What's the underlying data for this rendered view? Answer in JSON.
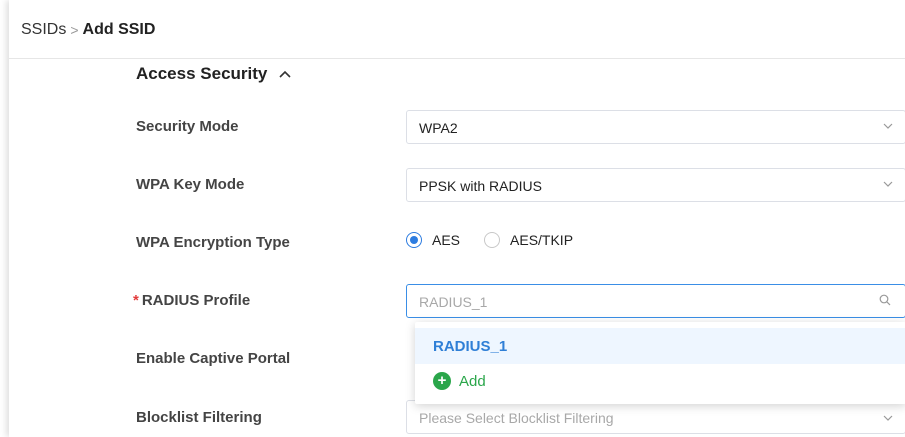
{
  "breadcrumb": {
    "parent": "SSIDs",
    "separator": ">",
    "current": "Add SSID"
  },
  "section": {
    "title": "Access Security"
  },
  "fields": {
    "security_mode": {
      "label": "Security Mode",
      "value": "WPA2"
    },
    "wpa_key_mode": {
      "label": "WPA Key Mode",
      "value": "PPSK with RADIUS"
    },
    "encryption": {
      "label": "WPA Encryption Type",
      "options": [
        "AES",
        "AES/TKIP"
      ],
      "selected": "AES"
    },
    "radius_profile": {
      "required_mark": "*",
      "label": "RADIUS Profile",
      "placeholder": "RADIUS_1"
    },
    "captive_portal": {
      "label": "Enable Captive Portal"
    },
    "blocklist": {
      "label": "Blocklist Filtering",
      "placeholder": "Please Select Blocklist Filtering"
    }
  },
  "dropdown": {
    "items": [
      "RADIUS_1"
    ],
    "add_label": "Add"
  },
  "colors": {
    "accent": "#2d7ce0",
    "add": "#2aa64a",
    "required": "#e23b3b"
  },
  "icons": {
    "section_toggle": "chevron-up-icon",
    "select": "chevron-down-icon",
    "search": "search-icon",
    "add": "plus-circle-icon"
  }
}
